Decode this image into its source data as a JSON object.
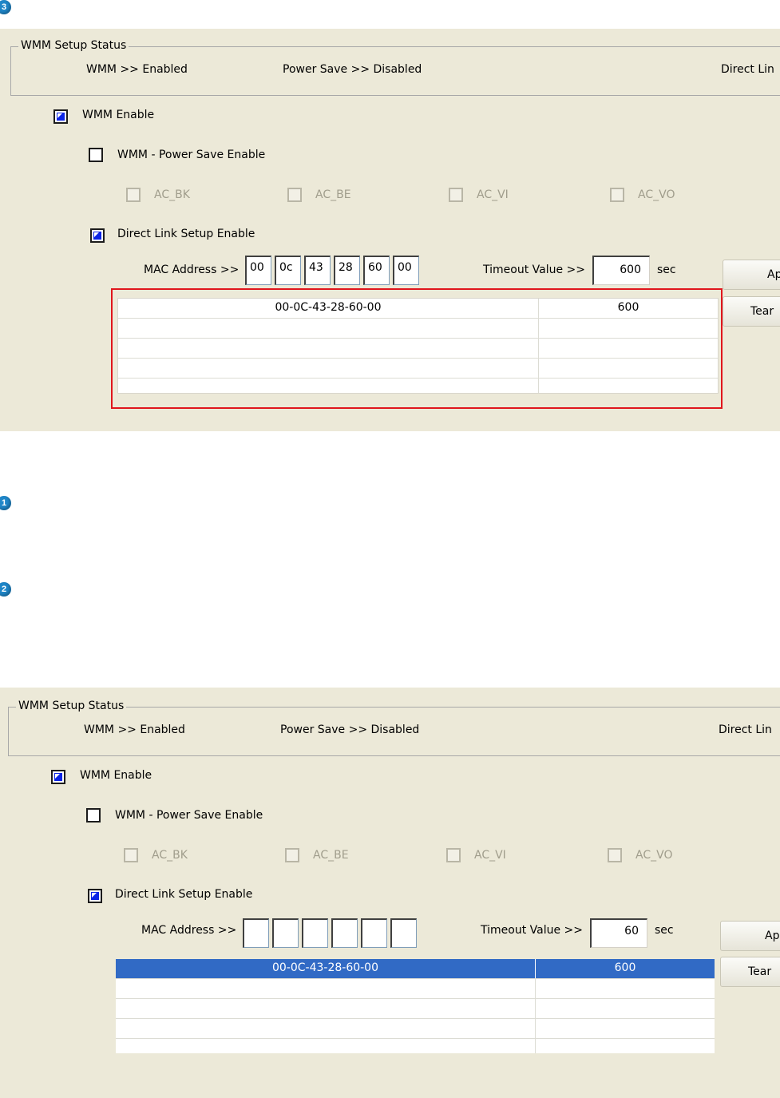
{
  "markers": [
    "3",
    "1",
    "2"
  ],
  "screens": [
    {
      "group_title": "WMM Setup Status",
      "status": {
        "wmm": "WMM >> Enabled",
        "power_save": "Power Save >> Disabled",
        "direct_link": "Direct Lin"
      },
      "wmm_enable": {
        "label": "WMM Enable",
        "checked": true
      },
      "power_save_enable": {
        "label": "WMM - Power Save Enable",
        "checked": false
      },
      "ac": [
        "AC_BK",
        "AC_BE",
        "AC_VI",
        "AC_VO"
      ],
      "dls_enable": {
        "label": "Direct Link Setup Enable",
        "checked": true
      },
      "mac_label": "MAC Address >>",
      "mac": [
        "00",
        "0c",
        "43",
        "28",
        "60",
        "00"
      ],
      "timeout_label": "Timeout Value >>",
      "timeout_value": "600",
      "sec": "sec",
      "apply_label": "Ap",
      "teardown_label": "Tear",
      "table": [
        {
          "mac": "00-0C-43-28-60-00",
          "timeout": "600",
          "selected": false
        },
        {
          "mac": "",
          "timeout": ""
        },
        {
          "mac": "",
          "timeout": ""
        },
        {
          "mac": "",
          "timeout": ""
        },
        {
          "mac": "",
          "timeout": ""
        }
      ],
      "highlight_color": "#e0161d"
    },
    {
      "group_title": "WMM Setup Status",
      "status": {
        "wmm": "WMM >> Enabled",
        "power_save": "Power Save >> Disabled",
        "direct_link": "Direct Lin"
      },
      "wmm_enable": {
        "label": "WMM Enable",
        "checked": true
      },
      "power_save_enable": {
        "label": "WMM - Power Save Enable",
        "checked": false
      },
      "ac": [
        "AC_BK",
        "AC_BE",
        "AC_VI",
        "AC_VO"
      ],
      "dls_enable": {
        "label": "Direct Link Setup Enable",
        "checked": true
      },
      "mac_label": "MAC Address >>",
      "mac": [
        "",
        "",
        "",
        "",
        "",
        ""
      ],
      "timeout_label": "Timeout Value >>",
      "timeout_value": "60",
      "sec": "sec",
      "apply_label": "Ap",
      "teardown_label": "Tear",
      "table": [
        {
          "mac": "00-0C-43-28-60-00",
          "timeout": "600",
          "selected": true
        },
        {
          "mac": "",
          "timeout": ""
        },
        {
          "mac": "",
          "timeout": ""
        },
        {
          "mac": "",
          "timeout": ""
        },
        {
          "mac": "",
          "timeout": ""
        }
      ],
      "selection_color": "#316ac5"
    }
  ]
}
